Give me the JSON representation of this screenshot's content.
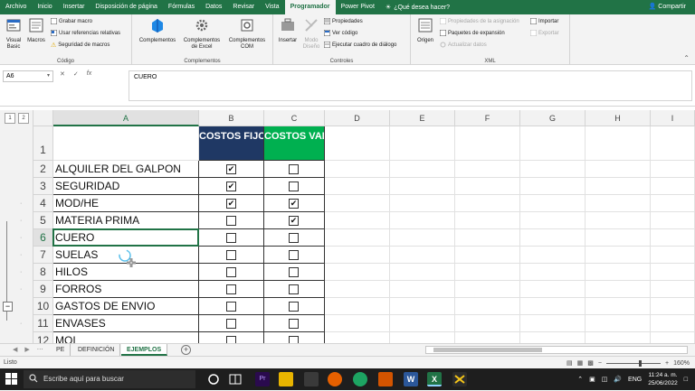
{
  "ribbon_tabs": [
    "Archivo",
    "Inicio",
    "Insertar",
    "Disposición de página",
    "Fórmulas",
    "Datos",
    "Revisar",
    "Vista",
    "Programador",
    "Power Pivot"
  ],
  "active_tab": "Programador",
  "tell_me": "¿Qué desea hacer?",
  "share": "Compartir",
  "ribbon": {
    "codigo": {
      "label": "Código",
      "visual_basic": "Visual Basic",
      "macros": "Macros",
      "grabar_macro": "Grabar macro",
      "usar_referencias": "Usar referencias relativas",
      "seguridad": "Seguridad de macros"
    },
    "complementos": {
      "label": "Complementos",
      "complementos": "Complementos",
      "complementos_excel": "Complementos de Excel",
      "complementos_com": "Complementos COM"
    },
    "controles": {
      "label": "Controles",
      "insertar": "Insertar",
      "modo_diseno": "Modo Diseño",
      "propiedades": "Propiedades",
      "ver_codigo": "Ver código",
      "ejecutar_cuadro": "Ejecutar cuadro de diálogo"
    },
    "xml": {
      "label": "XML",
      "origen": "Origen",
      "propiedades_asignacion": "Propiedades de la asignación",
      "paquetes_expansion": "Paquetes de expansión",
      "actualizar_datos": "Actualizar datos",
      "importar": "Importar",
      "exportar": "Exportar"
    }
  },
  "formula_bar": {
    "name_box": "A6",
    "icons": [
      "✕",
      "✓",
      "fx"
    ],
    "content": "CUERO"
  },
  "outline_levels": [
    "1",
    "2"
  ],
  "columns": [
    "A",
    "B",
    "C",
    "D",
    "E",
    "F",
    "G",
    "H",
    "I"
  ],
  "header_row": {
    "row": "1",
    "b": "COSTOS FIJOS",
    "c": "COSTOS VARIABLES"
  },
  "rows": [
    {
      "num": "2",
      "a": "ALQUILER DEL GALPON",
      "fijo": true,
      "variable": false
    },
    {
      "num": "3",
      "a": "SEGURIDAD",
      "fijo": true,
      "variable": false
    },
    {
      "num": "4",
      "a": "MOD/HE",
      "fijo": true,
      "variable": true
    },
    {
      "num": "5",
      "a": "MATERIA PRIMA",
      "fijo": false,
      "variable": true
    },
    {
      "num": "6",
      "a": "CUERO",
      "fijo": false,
      "variable": false
    },
    {
      "num": "7",
      "a": "SUELAS",
      "fijo": false,
      "variable": false
    },
    {
      "num": "8",
      "a": "HILOS",
      "fijo": false,
      "variable": false
    },
    {
      "num": "9",
      "a": "FORROS",
      "fijo": false,
      "variable": false
    },
    {
      "num": "10",
      "a": "GASTOS DE ENVIO",
      "fijo": false,
      "variable": false
    },
    {
      "num": "11",
      "a": "ENVASES",
      "fijo": false,
      "variable": false
    },
    {
      "num": "12",
      "a": "MOI",
      "fijo": false,
      "variable": false
    }
  ],
  "sheets": [
    "PE",
    "DEFINICIÓN",
    "EJEMPLOS"
  ],
  "active_sheet": "EJEMPLOS",
  "status": "Listo",
  "zoom": "160%",
  "taskbar": {
    "search_placeholder": "Escribe aquí para buscar",
    "lang": "ENG",
    "time": "11:24 a. m.",
    "date": "25/06/2022"
  },
  "colors": {
    "excel_green": "#217346",
    "header_blue": "#1f3864",
    "header_green": "#00b050"
  }
}
